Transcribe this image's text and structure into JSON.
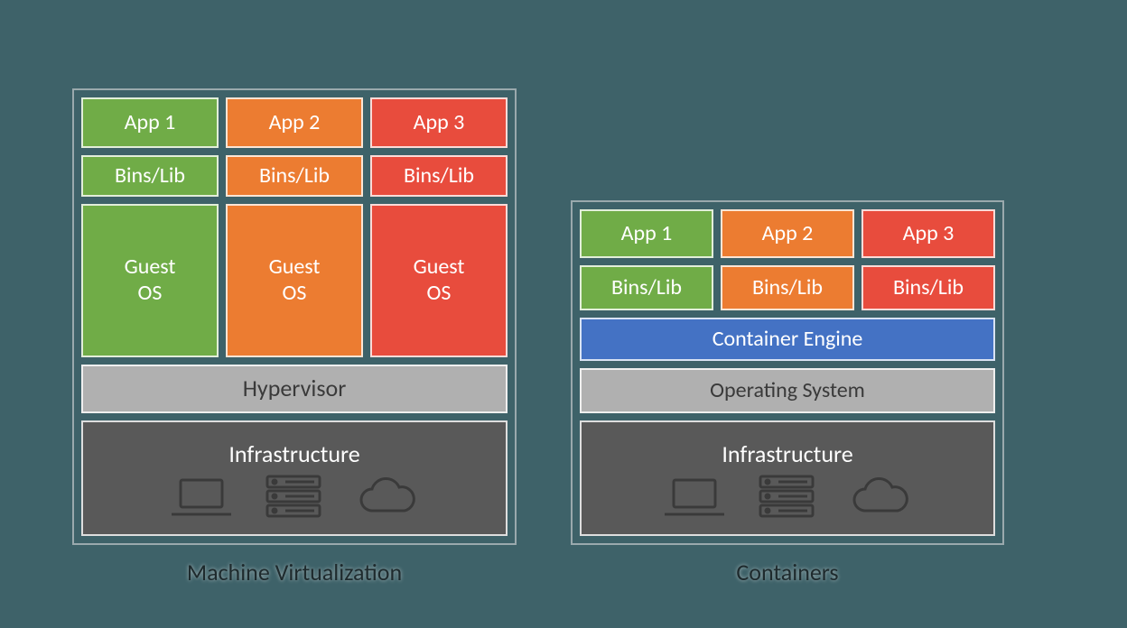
{
  "colors": {
    "green": "#70ac47",
    "orange": "#ec7c31",
    "red": "#e84c3d",
    "blue": "#4472c4",
    "grey": "#b0b0b0",
    "dark": "#595959",
    "page_bg": "#3e6269"
  },
  "vm": {
    "caption": "Machine Virtualization",
    "cols": [
      {
        "app": "App 1",
        "bins": "Bins/Lib",
        "guest": "Guest\nOS",
        "color": "green"
      },
      {
        "app": "App 2",
        "bins": "Bins/Lib",
        "guest": "Guest\nOS",
        "color": "orange"
      },
      {
        "app": "App 3",
        "bins": "Bins/Lib",
        "guest": "Guest\nOS",
        "color": "red"
      }
    ],
    "hypervisor": "Hypervisor",
    "infrastructure": "Infrastructure"
  },
  "ct": {
    "caption": "Containers",
    "cols": [
      {
        "app": "App 1",
        "bins": "Bins/Lib",
        "color": "green"
      },
      {
        "app": "App 2",
        "bins": "Bins/Lib",
        "color": "orange"
      },
      {
        "app": "App 3",
        "bins": "Bins/Lib",
        "color": "red"
      }
    ],
    "engine": "Container Engine",
    "os": "Operating System",
    "infrastructure": "Infrastructure"
  }
}
